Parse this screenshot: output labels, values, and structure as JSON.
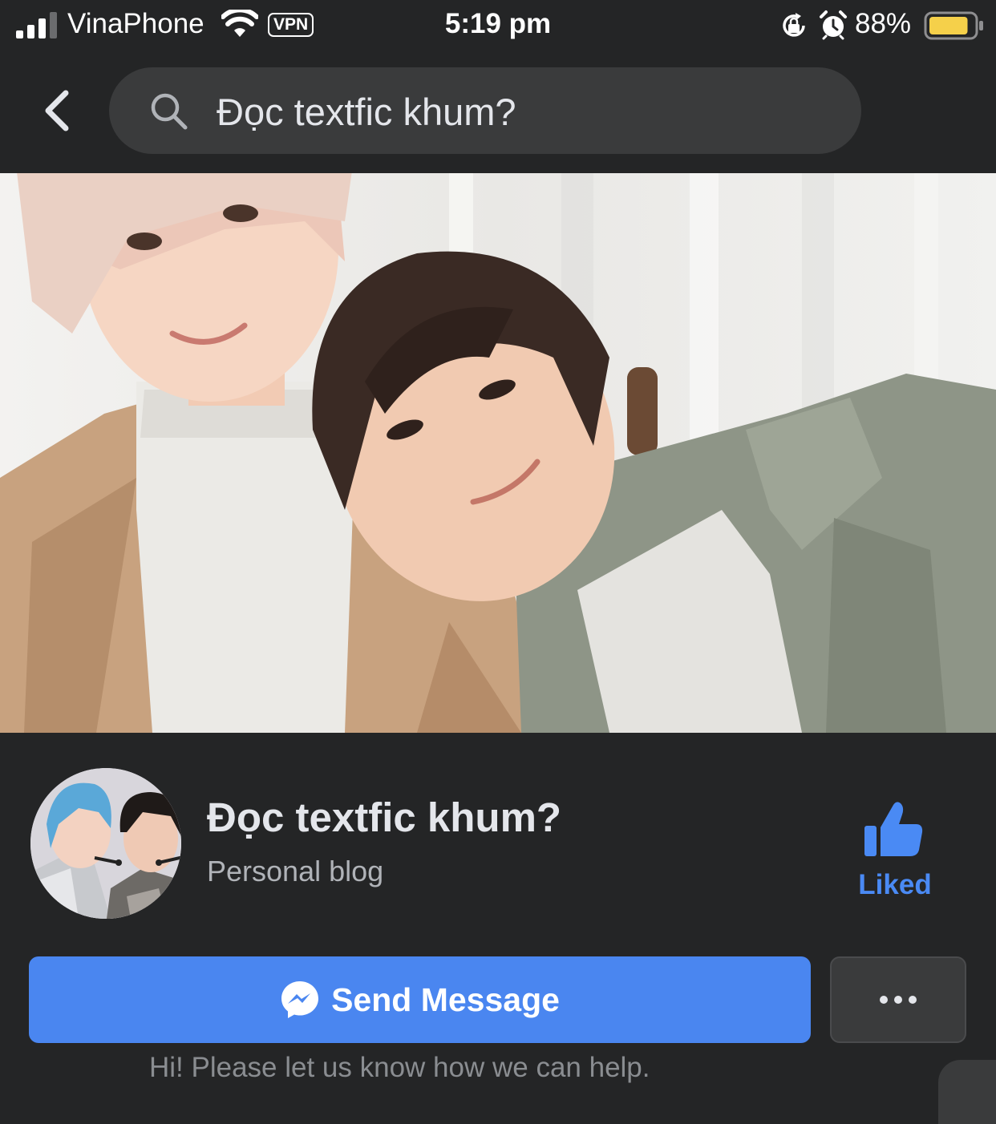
{
  "status_bar": {
    "carrier": "VinaPhone",
    "vpn": "VPN",
    "time": "5:19 pm",
    "battery_percent": "88%",
    "battery_level": 0.88,
    "battery_color": "#f5d04a",
    "icons": [
      "signal-icon",
      "wifi-icon",
      "rotation-lock-icon",
      "alarm-icon",
      "battery-icon"
    ]
  },
  "header": {
    "back_icon": "chevron-left-icon",
    "search_icon": "search-icon",
    "search_value": "Đọc textfic khum?"
  },
  "profile": {
    "name": "Đọc textfic khum?",
    "category": "Personal blog",
    "liked_label": "Liked",
    "liked_icon": "thumbs-up-icon",
    "accent_color": "#4a8af4"
  },
  "actions": {
    "send_message_label": "Send Message",
    "send_message_icon": "messenger-icon",
    "send_message_color": "#4a86f0",
    "more_icon": "more-dots-icon",
    "greeting": "Hi! Please let us know how we can help."
  }
}
